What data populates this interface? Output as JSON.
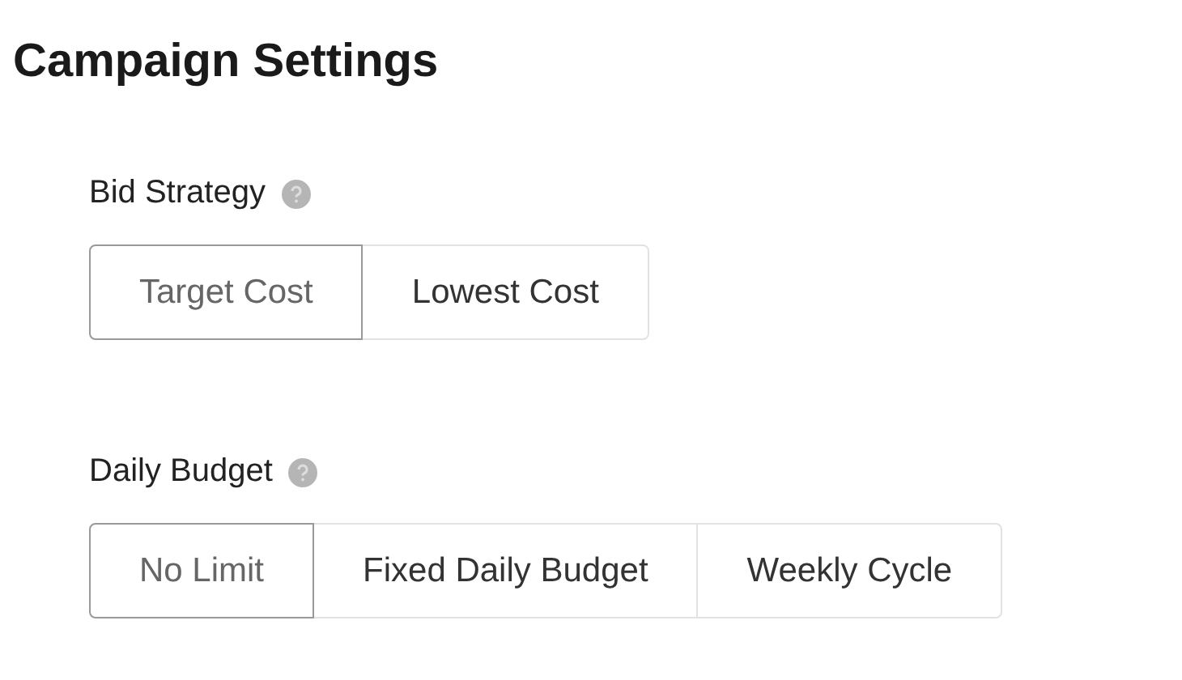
{
  "title": "Campaign Settings",
  "sections": [
    {
      "label": "Bid Strategy",
      "options": [
        {
          "label": "Target Cost",
          "selected": true
        },
        {
          "label": "Lowest Cost",
          "selected": false
        }
      ]
    },
    {
      "label": "Daily Budget",
      "options": [
        {
          "label": "No Limit",
          "selected": true
        },
        {
          "label": "Fixed Daily Budget",
          "selected": false
        },
        {
          "label": "Weekly Cycle",
          "selected": false
        }
      ]
    }
  ]
}
